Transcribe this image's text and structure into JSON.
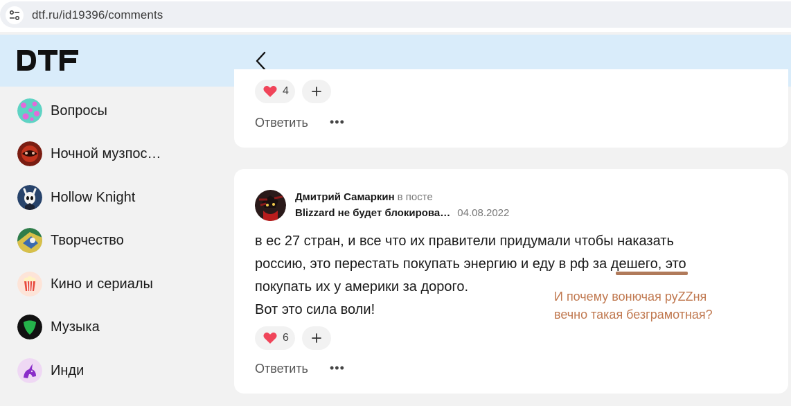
{
  "browser": {
    "url": "dtf.ru/id19396/comments",
    "site_info_icon": "tune-icon"
  },
  "header": {
    "logo": "DTF",
    "back_icon": "chevron-left-icon",
    "bg_color": "#d9ecfa"
  },
  "sidebar": {
    "items": [
      {
        "label": "Вопросы",
        "icon": "questions-avatar"
      },
      {
        "label": "Ночной музпос…",
        "icon": "night-music-avatar"
      },
      {
        "label": "Hollow Knight",
        "icon": "hollow-knight-avatar"
      },
      {
        "label": "Творчество",
        "icon": "creativity-avatar"
      },
      {
        "label": "Кино и сериалы",
        "icon": "popcorn-avatar"
      },
      {
        "label": "Музыка",
        "icon": "music-pick-avatar"
      },
      {
        "label": "Инди",
        "icon": "unicorn-avatar"
      }
    ]
  },
  "comments": [
    {
      "likes": "4",
      "reply_label": "Ответить",
      "more_label": "•••"
    },
    {
      "author": "Дмитрий Самаркин",
      "in_post_label": "в посте",
      "post_title": "Blizzard не будет блокирова…",
      "date": "04.08.2022",
      "text_line1": "в ес 27 стран, и все что их правители придумали чтобы наказать",
      "text_line2_a": "россию, это перестать покупать энергию и еду в рф ",
      "text_line2_b": "за дешего",
      "text_line2_c": ", это",
      "text_line3": "покупать их у америки за дорого.",
      "text_line4": "Вот это сила воли!",
      "likes": "6",
      "reply_label": "Ответить",
      "more_label": "•••"
    }
  ],
  "annotation": {
    "text": "И почему вонючая руZZня\nвечно такая безграмотная?",
    "color": "#c0784f"
  },
  "colors": {
    "heart": "#f0455a",
    "background": "#f2f2f2",
    "card": "#ffffff"
  }
}
